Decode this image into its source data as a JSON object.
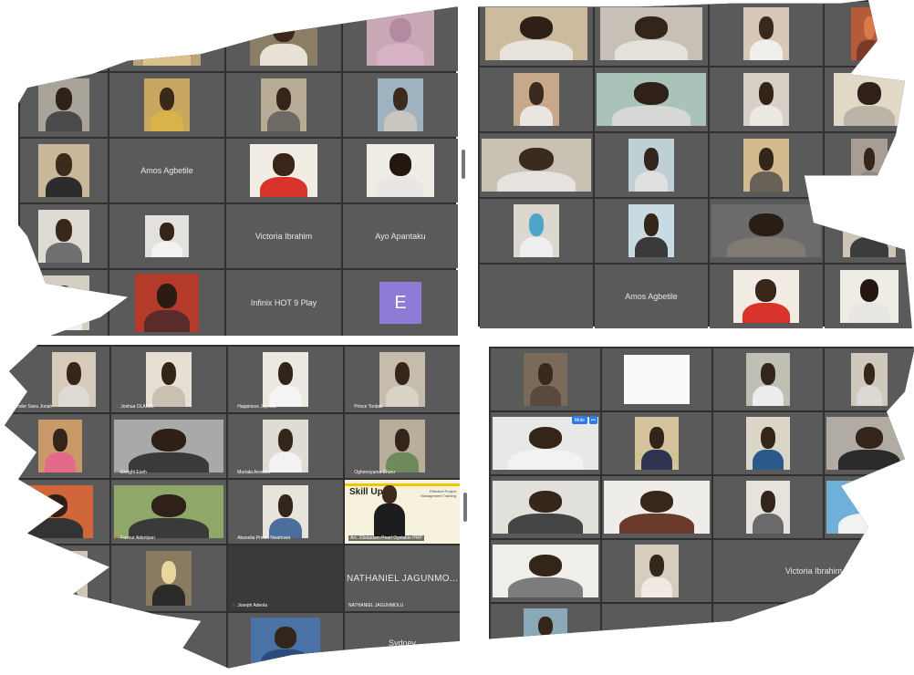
{
  "colors": {
    "tile": "#5a5a5a",
    "frame": "#2f2f2f",
    "avatar": "#8f7ad6",
    "accent": "#2c7be5",
    "skill_yellow": "#f3c400"
  },
  "panels": {
    "top_left": {
      "names": {
        "amos": "Amos Agbetile",
        "victoria": "Victoria Ibrahim",
        "ayo": "Ayo Apantaku",
        "infinix": "Infinix HOT 9 Play",
        "avatar_letter": "E"
      }
    },
    "top_right": {
      "names": {
        "amos": "Amos Agbetile"
      }
    },
    "bottom_left": {
      "labels": {
        "l1": "...ender Sanu Jonah",
        "l2": "Joshua OLAKJE",
        "l3": "Happiness Jayeola",
        "l4": "Prince Tonbali",
        "l5": "Enright Ezeh",
        "l6": "Murtala Arowolo",
        "l7": "Oghenoyama Ehuru",
        "l8": "Favour Adeniyan",
        "l9": "Akanelia Prince Nwahuwa",
        "l10": "Arc. Eboladam Pearl Oyelakin PMP",
        "l11": "Joseph Adeola",
        "l12": "NATHANIEL JAGUNMOLU"
      },
      "nathaniel_big": "NATHANIEL JAGUNMO...",
      "sydney": "Sydney",
      "skill": {
        "brand": "Skill Up",
        "sub": "Effective Project Management Training"
      }
    },
    "bottom_right": {
      "names": {
        "victoria": "Victoria Ibrahim"
      },
      "pill_mute": "Mute"
    }
  }
}
